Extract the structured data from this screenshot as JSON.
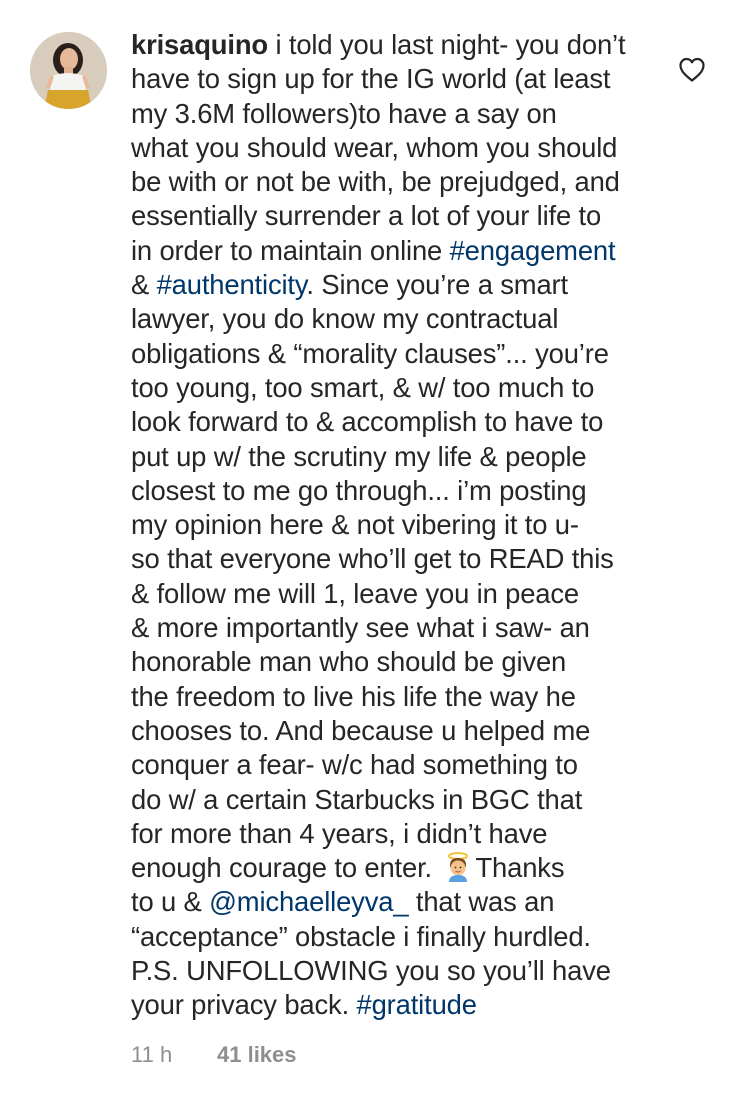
{
  "comment": {
    "username": "krisaquino",
    "lines": [
      " i told you last night- you don’t",
      "have to sign up for the IG world (at least",
      "my 3.6M followers)to have a say on",
      "what you should wear, whom you should",
      "be with or not be with, be prejudged, and",
      "essentially surrender a lot of your life to",
      "in order to maintain online ",
      "& ",
      ". Since you’re a smart",
      "lawyer, you do know my contractual",
      "obligations & “morality clauses”... you’re",
      "too young, too smart, & w/ too much to",
      "look forward to & accomplish to have to",
      "put up w/ the scrutiny my life & people",
      "closest to me go through... i’m posting",
      "my opinion here & not vibering it to u-",
      "so that everyone who’ll get to READ this",
      "& follow me will 1, leave you in peace",
      "& more importantly see what i saw- an",
      "honorable man who should be given",
      "the freedom to live his life the way he",
      "chooses to. And because u helped me",
      "conquer a fear- w/c had something to",
      "do w/ a certain Starbucks in BGC that",
      "for more than 4 years, i didn’t have",
      "enough courage to enter. ",
      "Thanks",
      "to u & ",
      " that was an",
      "“acceptance” obstacle i finally hurdled.",
      "P.S. UNFOLLOWING you so you’ll have",
      "your privacy back. "
    ],
    "hashtags": {
      "engagement": "#engagement",
      "authenticity": "#authenticity",
      "gratitude": "#gratitude"
    },
    "mention": "@michaelleyva_",
    "emoji": "angel-emoji"
  },
  "meta": {
    "time": "11 h",
    "likes": "41 likes"
  },
  "icons": {
    "like": "heart-outline-icon",
    "avatar": "profile-avatar"
  },
  "colors": {
    "text": "#262626",
    "link": "#00376b",
    "muted": "#8e8e8e"
  }
}
